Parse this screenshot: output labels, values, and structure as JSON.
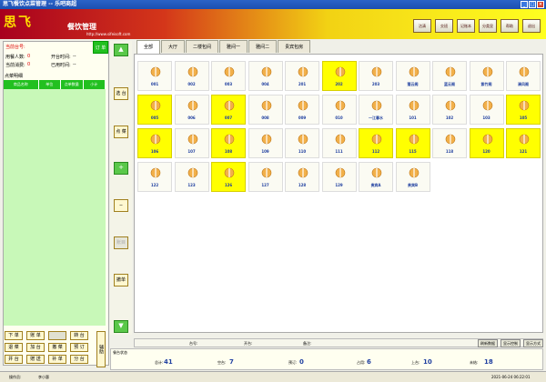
{
  "window": {
    "title": "思飞餐饮点菜管理 -- 乐吧商超"
  },
  "banner": {
    "logo": "思飞",
    "app_name": "餐饮管理",
    "url": "http://www.sifeisoft.com"
  },
  "top_buttons": [
    "沽清",
    "交班",
    "记账本",
    "分类显",
    "帮助",
    "退出"
  ],
  "left": {
    "current_table_label": "当前台号:",
    "diners_label": "用餐人数:",
    "diners": "0",
    "open_time_label": "开台时间:",
    "open_time": "--",
    "consumption_label": "当前消费:",
    "consumption": "0",
    "used_time_label": "已用时间:",
    "used_time": "--",
    "order_button": "订 单",
    "dish_detail_label": "点菜明细",
    "columns": [
      "商品名称",
      "单位",
      "点单数量",
      "小计"
    ]
  },
  "bottom_buttons": [
    "下 单",
    "账 单",
    "",
    "转 台",
    "退 菜",
    "加 台",
    "撤 菜",
    "预 订",
    "并 台",
    "赠 送",
    "补 单",
    "分 台"
  ],
  "bottom_buttons_disabled": [
    false,
    false,
    true,
    false,
    false,
    false,
    false,
    false,
    false,
    false,
    false,
    false
  ],
  "fuzhu_button": "辅助",
  "mid_buttons": {
    "up": "▲",
    "select": "选 台",
    "order": "点 菜",
    "plus": "+",
    "minus": "−",
    "manage": "账目",
    "delete": "撤单",
    "down": "▼"
  },
  "tabs": [
    "全部",
    "大厅",
    "二楼包间",
    "雅间一",
    "雅间二",
    "贵宾包房"
  ],
  "tables": [
    {
      "name": "001",
      "occupied": false
    },
    {
      "name": "002",
      "occupied": false
    },
    {
      "name": "003",
      "occupied": false
    },
    {
      "name": "004",
      "occupied": false
    },
    {
      "name": "201",
      "occupied": false
    },
    {
      "name": "202",
      "occupied": true
    },
    {
      "name": "203",
      "occupied": false
    },
    {
      "name": "蓬云阁",
      "occupied": false
    },
    {
      "name": "蓝云阁",
      "occupied": false
    },
    {
      "name": "紫竹阁",
      "occupied": false
    },
    {
      "name": "清风阁",
      "occupied": false
    },
    {
      "name": "005",
      "occupied": true
    },
    {
      "name": "006",
      "occupied": false
    },
    {
      "name": "007",
      "occupied": true
    },
    {
      "name": "008",
      "occupied": false
    },
    {
      "name": "009",
      "occupied": false
    },
    {
      "name": "010",
      "occupied": false
    },
    {
      "name": "一江春水",
      "occupied": false
    },
    {
      "name": "101",
      "occupied": false
    },
    {
      "name": "102",
      "occupied": false
    },
    {
      "name": "103",
      "occupied": false
    },
    {
      "name": "105",
      "occupied": true
    },
    {
      "name": "106",
      "occupied": true
    },
    {
      "name": "107",
      "occupied": false
    },
    {
      "name": "108",
      "occupied": true
    },
    {
      "name": "109",
      "occupied": false
    },
    {
      "name": "110",
      "occupied": false
    },
    {
      "name": "111",
      "occupied": false
    },
    {
      "name": "112",
      "occupied": true
    },
    {
      "name": "115",
      "occupied": true
    },
    {
      "name": "118",
      "occupied": false
    },
    {
      "name": "120",
      "occupied": true
    },
    {
      "name": "121",
      "occupied": true
    },
    {
      "name": "122",
      "occupied": false
    },
    {
      "name": "123",
      "occupied": false
    },
    {
      "name": "126",
      "occupied": true
    },
    {
      "name": "127",
      "occupied": false
    },
    {
      "name": "128",
      "occupied": false
    },
    {
      "name": "129",
      "occupied": false
    },
    {
      "name": "贵宾A",
      "occupied": false
    },
    {
      "name": "贵宾B",
      "occupied": false
    }
  ],
  "status_bar": {
    "table_label": "台号:",
    "time_label": "开台:",
    "remark_label": "备注:",
    "refresh": "刷新数据",
    "display_options": "显示控制",
    "view_options": "显示方式"
  },
  "summary": {
    "caption": "餐台状态",
    "items": [
      {
        "label": "总计:",
        "value": "41"
      },
      {
        "label": "空台:",
        "value": "7"
      },
      {
        "label": "预订:",
        "value": "0"
      },
      {
        "label": "占用:",
        "value": "6"
      },
      {
        "label": "上台:",
        "value": "10"
      },
      {
        "label": "未结:",
        "value": "18"
      }
    ]
  },
  "footer": {
    "operator_label": "操作员:",
    "operator": "李小惠",
    "datetime": "2021-06-24 06:22:01"
  },
  "colors": {
    "occupied": "#ffff00",
    "green": "#22c020",
    "banner_red": "#a8001e",
    "banner_yellow": "#ffff20"
  }
}
